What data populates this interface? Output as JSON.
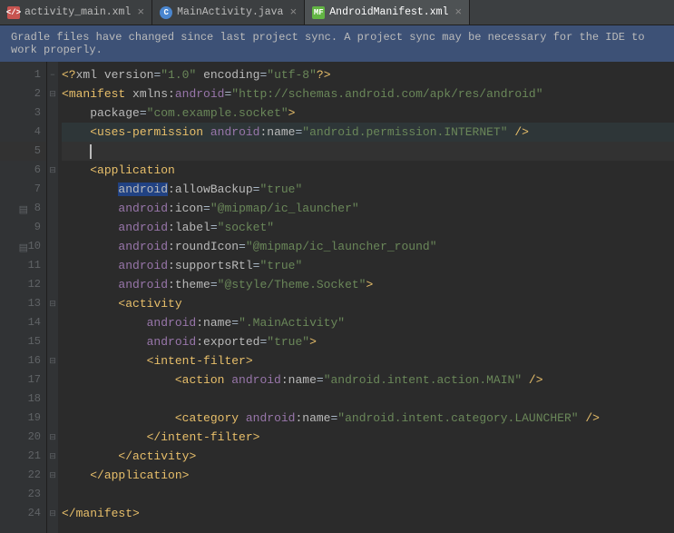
{
  "tabs": [
    {
      "icon": "xml",
      "iconText": "</>",
      "label": "activity_main.xml",
      "active": false
    },
    {
      "icon": "java",
      "iconText": "C",
      "label": "MainActivity.java",
      "active": false
    },
    {
      "icon": "mf",
      "iconText": "MF",
      "label": "AndroidManifest.xml",
      "active": true
    }
  ],
  "notification": "Gradle files have changed since last project sync. A project sync may be necessary for the IDE to work properly.",
  "lineCount": 24,
  "currentLine": 5,
  "highlightedLine": 4,
  "gutterIcons": {
    "8": "▤",
    "10": "▤"
  },
  "foldMarks": {
    "1": "−",
    "2": "⊟",
    "6": "⊟",
    "13": "⊟",
    "16": "⊟",
    "20": "⊟",
    "21": "⊟",
    "22": "⊟",
    "24": "⊟"
  },
  "code": {
    "l1": {
      "a": "<?",
      "b": "xml version",
      "c": "=",
      "d": "\"1.0\"",
      "e": " encoding",
      "f": "=",
      "g": "\"utf-8\"",
      "h": "?>"
    },
    "l2": {
      "a": "<",
      "b": "manifest ",
      "c": "xmlns:",
      "d": "android",
      "e": "=",
      "f": "\"http://schemas.android.com/apk/res/android\""
    },
    "l3": {
      "a": "package",
      "b": "=",
      "c": "\"com.example.socket\"",
      "d": ">"
    },
    "l4": {
      "a": "<",
      "b": "uses-permission ",
      "c": "android",
      "d": ":name",
      "e": "=",
      "f": "\"android.permission.INTERNET\"",
      "g": " />"
    },
    "l6": {
      "a": "<",
      "b": "application"
    },
    "l7": {
      "a": "android",
      "b": ":allowBackup",
      "c": "=",
      "d": "\"true\""
    },
    "l8": {
      "a": "android",
      "b": ":icon",
      "c": "=",
      "d": "\"@mipmap/ic_launcher\""
    },
    "l9": {
      "a": "android",
      "b": ":label",
      "c": "=",
      "d": "\"socket\""
    },
    "l10": {
      "a": "android",
      "b": ":roundIcon",
      "c": "=",
      "d": "\"@mipmap/ic_launcher_round\""
    },
    "l11": {
      "a": "android",
      "b": ":supportsRtl",
      "c": "=",
      "d": "\"true\""
    },
    "l12": {
      "a": "android",
      "b": ":theme",
      "c": "=",
      "d": "\"@style/Theme.Socket\"",
      "e": ">"
    },
    "l13": {
      "a": "<",
      "b": "activity"
    },
    "l14": {
      "a": "android",
      "b": ":name",
      "c": "=",
      "d": "\".MainActivity\""
    },
    "l15": {
      "a": "android",
      "b": ":exported",
      "c": "=",
      "d": "\"true\"",
      "e": ">"
    },
    "l16": {
      "a": "<",
      "b": "intent-filter",
      "c": ">"
    },
    "l17": {
      "a": "<",
      "b": "action ",
      "c": "android",
      "d": ":name",
      "e": "=",
      "f": "\"android.intent.action.MAIN\"",
      "g": " />"
    },
    "l19": {
      "a": "<",
      "b": "category ",
      "c": "android",
      "d": ":name",
      "e": "=",
      "f": "\"android.intent.category.LAUNCHER\"",
      "g": " />"
    },
    "l20": {
      "a": "</",
      "b": "intent-filter",
      "c": ">"
    },
    "l21": {
      "a": "</",
      "b": "activity",
      "c": ">"
    },
    "l22": {
      "a": "</",
      "b": "application",
      "c": ">"
    },
    "l24": {
      "a": "</",
      "b": "manifest",
      "c": ">"
    }
  }
}
